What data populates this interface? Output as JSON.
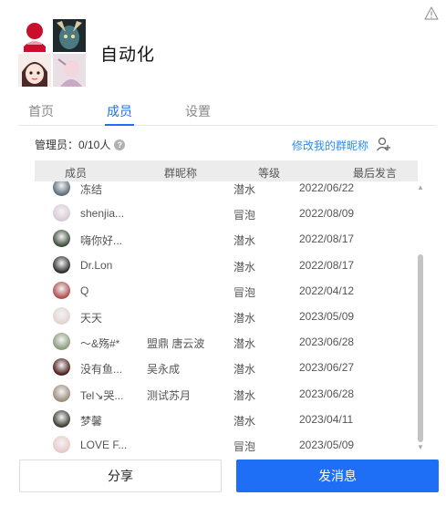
{
  "group": {
    "name": "自动化"
  },
  "tabs": [
    {
      "label": "首页"
    },
    {
      "label": "成员"
    },
    {
      "label": "设置"
    }
  ],
  "admins": {
    "label": "管理员：0/10人"
  },
  "edit_nickname": "修改我的群昵称",
  "table": {
    "headers": [
      "成员",
      "群昵称",
      "等级",
      "最后发言"
    ],
    "rows": [
      {
        "name": "冻结",
        "group_nick": "",
        "level": "潜水",
        "date": "2022/06/22",
        "color": "#5a6a7a"
      },
      {
        "name": "shenjia...",
        "group_nick": "",
        "level": "冒泡",
        "date": "2022/08/09",
        "color": "#d8c9d6"
      },
      {
        "name": "嗨你好...",
        "group_nick": "",
        "level": "潜水",
        "date": "2022/08/17",
        "color": "#3a4a3a"
      },
      {
        "name": "Dr.Lon",
        "group_nick": "",
        "level": "潜水",
        "date": "2022/08/17",
        "color": "#2a2a2a"
      },
      {
        "name": "Q",
        "group_nick": "",
        "level": "冒泡",
        "date": "2022/04/12",
        "color": "#b04a4a"
      },
      {
        "name": "天天",
        "group_nick": "",
        "level": "潜水",
        "date": "2023/05/09",
        "color": "#e2d4d0"
      },
      {
        "name": "～&殇#*",
        "group_nick": "盟鼎 唐云波",
        "level": "潜水",
        "date": "2023/06/28",
        "color": "#8a9a7a"
      },
      {
        "name": "没有鱼...",
        "group_nick": "吴永成",
        "level": "潜水",
        "date": "2023/06/27",
        "color": "#4a1a1a"
      },
      {
        "name": "Tel↘哭...",
        "group_nick": "测试苏月",
        "level": "潜水",
        "date": "2023/06/28",
        "color": "#9a8a7a"
      },
      {
        "name": "梦馨",
        "group_nick": "",
        "level": "潜水",
        "date": "2023/04/11",
        "color": "#3a3a30"
      },
      {
        "name": "LOVE F...",
        "group_nick": "",
        "level": "冒泡",
        "date": "2023/05/09",
        "color": "#e8c8c8"
      }
    ]
  },
  "buttons": {
    "share": "分享",
    "send": "发消息"
  },
  "colors": {
    "accent": "#1e6ff5",
    "link": "#2d8cf0"
  }
}
